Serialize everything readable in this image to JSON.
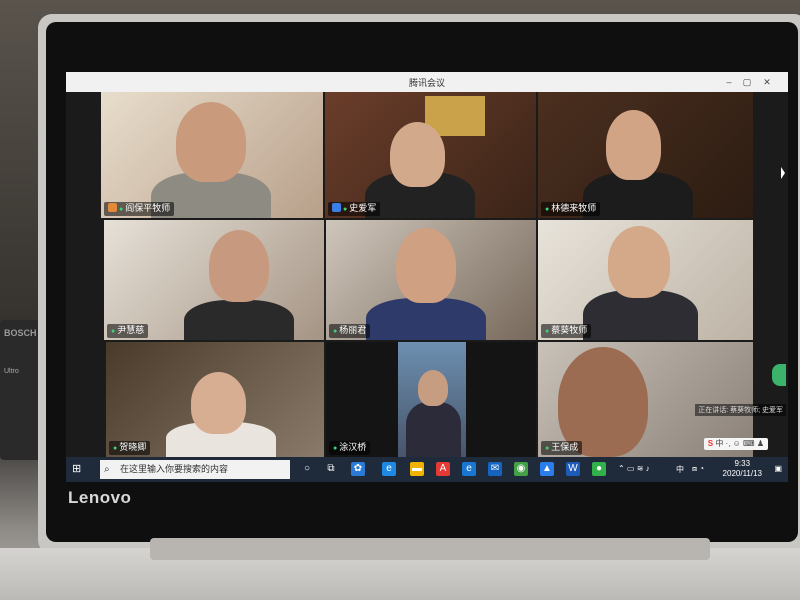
{
  "app": {
    "title": "腾讯会议"
  },
  "participants": [
    {
      "name": "阎保平牧师",
      "role": "host"
    },
    {
      "name": "史爱军",
      "role": "cohost"
    },
    {
      "name": "林德来牧师",
      "role": ""
    },
    {
      "name": "尹慧慈",
      "role": ""
    },
    {
      "name": "杨丽君",
      "role": ""
    },
    {
      "name": "蔡葵牧师",
      "role": ""
    },
    {
      "name": "贺晓卿",
      "role": ""
    },
    {
      "name": "涂汉桥",
      "role": ""
    },
    {
      "name": "王保成",
      "role": ""
    }
  ],
  "speaking": {
    "text": "正在讲话: 蔡葵牧师; 史爱军"
  },
  "ime": {
    "label": "S",
    "text": "中 ·, ☺ ⌨ ♟"
  },
  "taskbar": {
    "search_placeholder": "在这里输入你要搜索的内容",
    "time": "9:33",
    "date": "2020/11/13",
    "ime_indicator": "中",
    "app_icons": [
      "cortana-icon",
      "task-view-icon",
      "tencent-meeting-icon",
      "edge-icon",
      "file-explorer-icon",
      "office-icon",
      "edge-legacy-icon",
      "mail-icon",
      "chrome-icon",
      "meeting-app-icon",
      "word-icon",
      "wechat-icon"
    ]
  },
  "device": {
    "brand": "Lenovo",
    "speaker_brand": "BOSCH",
    "speaker_model": "Ultro"
  },
  "colors": {
    "titlebar": "#f1f1f1",
    "taskbar": "#1f2a3a",
    "mic_active": "#3fd17a"
  }
}
